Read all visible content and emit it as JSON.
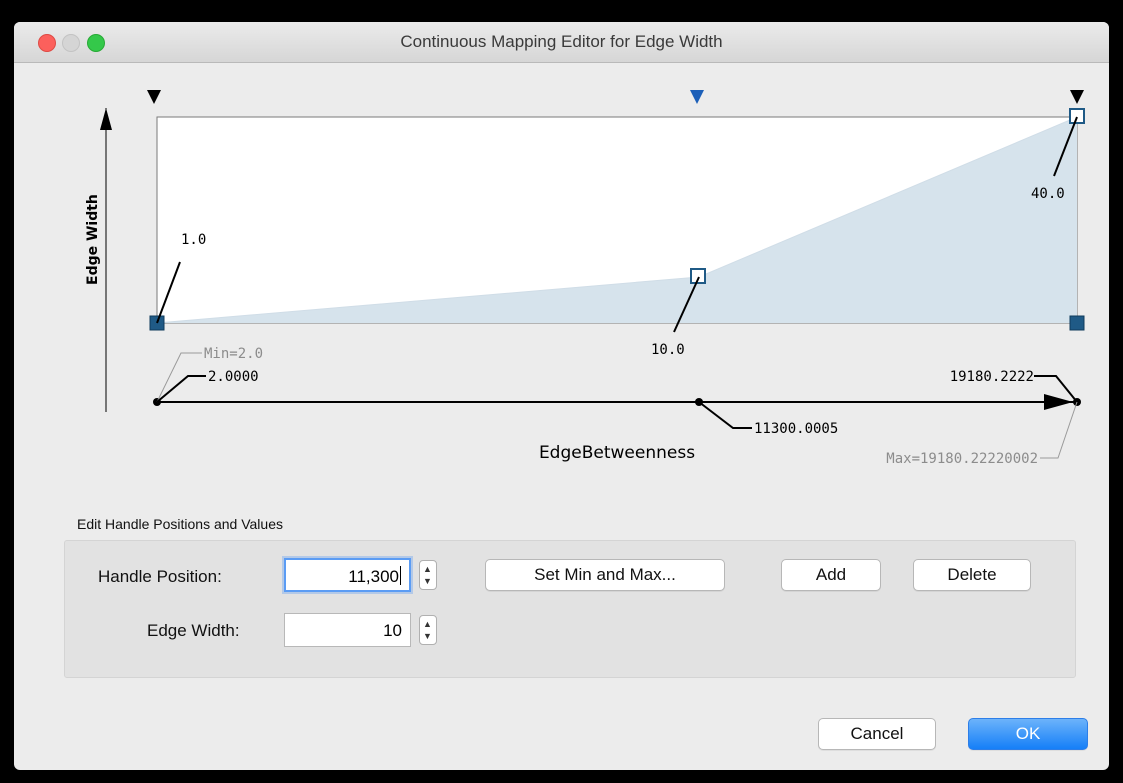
{
  "window": {
    "title": "Continuous Mapping Editor for Edge Width"
  },
  "plot": {
    "y_axis_label": "Edge Width",
    "x_axis_label": "EdgeBetweenness",
    "fill_color": "#d6e3ec",
    "handle_color": "#1f5a86",
    "selected_arrow_color": "#1c5fb8",
    "value_labels": {
      "left": "1.0",
      "mid": "10.0",
      "right": "40.0"
    },
    "min_label": "Min=2.0",
    "max_label": "Max=19180.22220002",
    "handle_labels": {
      "left": "2.0000",
      "mid": "11300.0005",
      "right": "19180.2222"
    }
  },
  "chart_data": {
    "type": "area",
    "x": [
      2.0,
      11300.0005,
      19180.2222
    ],
    "y": [
      1.0,
      10.0,
      40.0
    ],
    "xlabel": "EdgeBetweenness",
    "ylabel": "Edge Width",
    "xlim": [
      2.0,
      19180.2222
    ]
  },
  "editor": {
    "section_label": "Edit Handle Positions and Values",
    "handle_position_label": "Handle Position:",
    "handle_position_value": "11,300",
    "edge_width_label": "Edge Width:",
    "edge_width_value": "10",
    "set_min_max_button": "Set Min and Max...",
    "add_button": "Add",
    "delete_button": "Delete"
  },
  "footer": {
    "cancel_button": "Cancel",
    "ok_button": "OK"
  }
}
